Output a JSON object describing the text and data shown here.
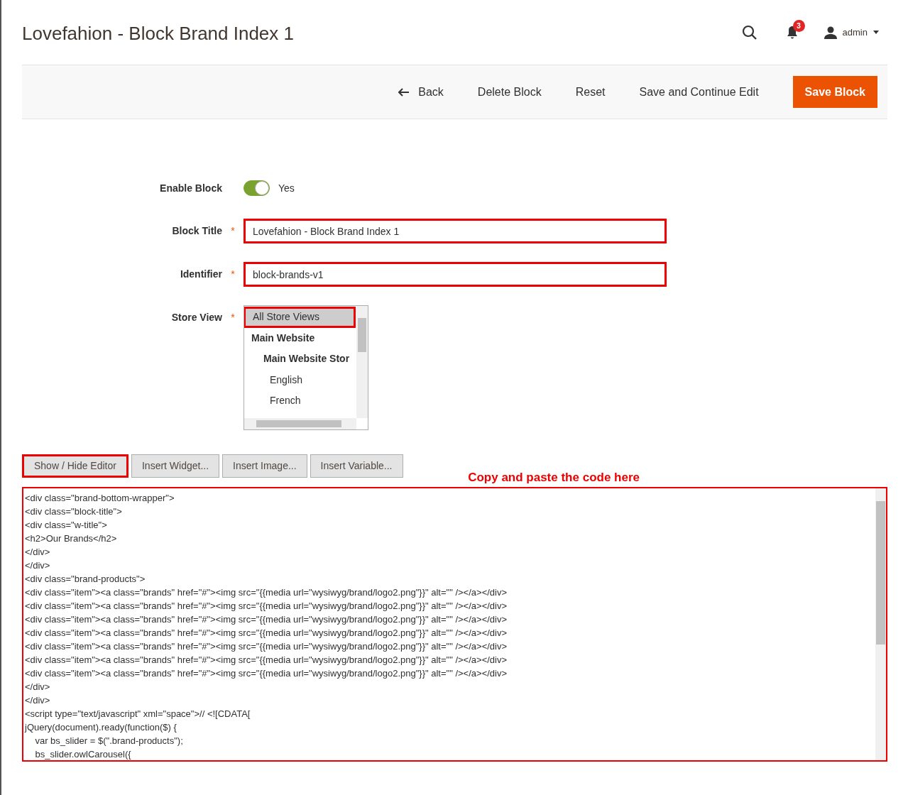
{
  "page_title": "Lovefahion - Block Brand Index 1",
  "header": {
    "notifications_count": "3",
    "user": "admin"
  },
  "actions": [
    {
      "label": "Back",
      "kind": "back"
    },
    {
      "label": "Delete Block",
      "kind": "plain"
    },
    {
      "label": "Reset",
      "kind": "plain"
    },
    {
      "label": "Save and Continue Edit",
      "kind": "plain"
    },
    {
      "label": "Save Block",
      "kind": "primary"
    }
  ],
  "form": {
    "enable_block": {
      "label": "Enable Block",
      "on": true,
      "value_label": "Yes"
    },
    "block_title": {
      "label": "Block Title",
      "required_mark": "*",
      "value": "Lovefahion - Block Brand Index 1",
      "highlighted": true
    },
    "identifier": {
      "label": "Identifier",
      "required_mark": "*",
      "value": "block-brands-v1",
      "highlighted": true
    },
    "store_view": {
      "label": "Store View",
      "required_mark": "*",
      "options": [
        {
          "label": "All Store Views",
          "selected": true,
          "highlighted": true,
          "kind": "option"
        },
        {
          "label": "Main Website",
          "selected": false,
          "kind": "group",
          "children": [
            {
              "label": "Main Website Stor",
              "selected": false,
              "kind": "group",
              "children": [
                {
                  "label": "English",
                  "selected": false,
                  "kind": "option"
                },
                {
                  "label": "French",
                  "selected": false,
                  "kind": "option"
                }
              ]
            }
          ]
        }
      ]
    }
  },
  "editor_buttons": [
    {
      "label": "Show / Hide Editor",
      "highlighted": true
    },
    {
      "label": "Insert Widget...",
      "highlighted": false
    },
    {
      "label": "Insert Image...",
      "highlighted": false
    },
    {
      "label": "Insert Variable...",
      "highlighted": false
    }
  ],
  "annotation": "Copy and paste the code here",
  "editor_lines": [
    "<div class=\"brand-bottom-wrapper\">",
    "<div class=\"block-title\">",
    "<div class=\"w-title\">",
    "<h2>Our Brands</h2>",
    "</div>",
    "</div>",
    "<div class=\"brand-products\">",
    "<div class=\"item\"><a class=\"brands\" href=\"#\"><img src=\"{{media url=\"wysiwyg/brand/logo2.png\"}}\" alt=\"\" /></a></div>",
    "<div class=\"item\"><a class=\"brands\" href=\"#\"><img src=\"{{media url=\"wysiwyg/brand/logo2.png\"}}\" alt=\"\" /></a></div>",
    "<div class=\"item\"><a class=\"brands\" href=\"#\"><img src=\"{{media url=\"wysiwyg/brand/logo2.png\"}}\" alt=\"\" /></a></div>",
    "<div class=\"item\"><a class=\"brands\" href=\"#\"><img src=\"{{media url=\"wysiwyg/brand/logo2.png\"}}\" alt=\"\" /></a></div>",
    "<div class=\"item\"><a class=\"brands\" href=\"#\"><img src=\"{{media url=\"wysiwyg/brand/logo2.png\"}}\" alt=\"\" /></a></div>",
    "<div class=\"item\"><a class=\"brands\" href=\"#\"><img src=\"{{media url=\"wysiwyg/brand/logo2.png\"}}\" alt=\"\" /></a></div>",
    "<div class=\"item\"><a class=\"brands\" href=\"#\"><img src=\"{{media url=\"wysiwyg/brand/logo2.png\"}}\" alt=\"\" /></a></div>",
    "</div>",
    "</div>",
    "<script type=\"text/javascript\" xml=\"space\">// <![CDATA[",
    "jQuery(document).ready(function($) {",
    "\tvar bs_slider = $(\".brand-products\");",
    "\tbs_slider.owlCarousel({"
  ]
}
